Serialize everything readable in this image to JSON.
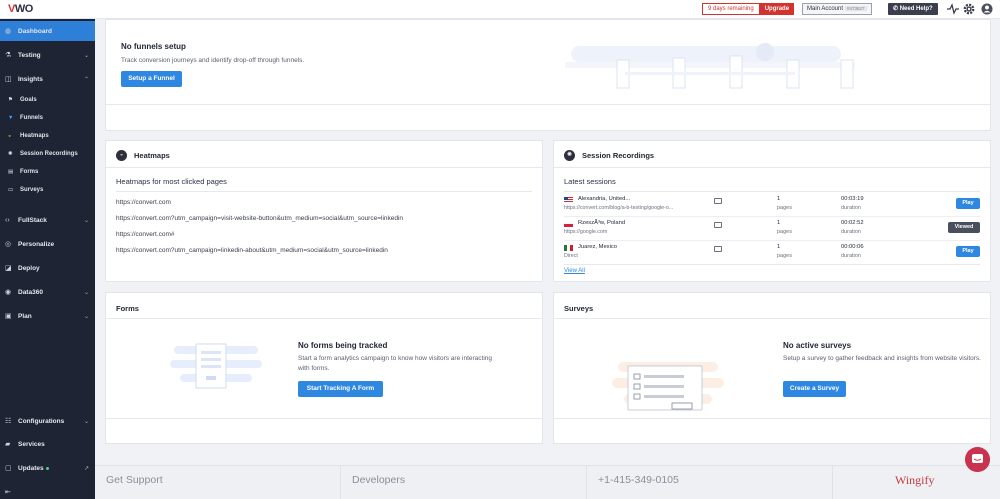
{
  "topbar": {
    "logo_prefix": "V",
    "logo_suffix": "WO",
    "trial_remaining": "9 days remaining",
    "upgrade_label": "Upgrade",
    "account_label": "Main Account",
    "account_id": "#473627",
    "help_label": "Need Help?",
    "icons": [
      "activity-icon",
      "gear-icon",
      "user-icon"
    ]
  },
  "sidebar": {
    "items": [
      {
        "label": "Dashboard",
        "icon": "dashboard-icon",
        "active": true
      },
      {
        "label": "Testing",
        "icon": "flask-icon",
        "chevron": "⌄"
      },
      {
        "label": "Insights",
        "icon": "insights-icon",
        "chevron": "⌃"
      },
      {
        "label": "FullStack",
        "icon": "code-icon",
        "chevron": "⌄"
      },
      {
        "label": "Personalize",
        "icon": "target-icon"
      },
      {
        "label": "Deploy",
        "icon": "deploy-icon"
      },
      {
        "label": "Data360",
        "icon": "database-icon",
        "chevron": "⌄"
      },
      {
        "label": "Plan",
        "icon": "plan-icon",
        "chevron": "⌄"
      },
      {
        "label": "Configurations",
        "icon": "sliders-icon",
        "chevron": "⌄"
      },
      {
        "label": "Services",
        "icon": "briefcase-icon"
      },
      {
        "label": "Updates",
        "icon": "bell-icon"
      }
    ],
    "insights_sub": [
      {
        "label": "Goals",
        "icon": "flag-icon"
      },
      {
        "label": "Funnels",
        "icon": "funnel-icon"
      },
      {
        "label": "Heatmaps",
        "icon": "heatmap-icon"
      },
      {
        "label": "Session Recordings",
        "icon": "recording-icon"
      },
      {
        "label": "Forms",
        "icon": "form-icon"
      },
      {
        "label": "Surveys",
        "icon": "survey-icon"
      }
    ],
    "collapse_icon": "collapse-icon"
  },
  "funnels": {
    "title": "No funnels setup",
    "description": "Track conversion journeys and identify drop-off through funnels.",
    "button": "Setup a Funnel"
  },
  "heatmaps": {
    "title": "Heatmaps",
    "subtitle": "Heatmaps for most clicked pages",
    "links": [
      "https://convert.com",
      "https://convert.com?utm_campaign=visit-website-button&utm_medium=social&utm_source=linkedin",
      "https://convert.com#",
      "https://convert.com?utm_campaign=linkedin-about&utm_medium=social&utm_source=linkedin"
    ]
  },
  "sessions": {
    "title": "Session Recordings",
    "subtitle": "Latest sessions",
    "rows": [
      {
        "location": "Alexandria, United...",
        "source": "https://convert.com/blog/a-b-testing/google-o...",
        "pages": "1",
        "pages_label": "pages",
        "duration": "00:03:19",
        "duration_label": "duration",
        "action": "Play",
        "flag": "us"
      },
      {
        "location": "RzeszÃ³w, Poland",
        "source": "https://google.com",
        "pages": "1",
        "pages_label": "pages",
        "duration": "00:02:52",
        "duration_label": "duration",
        "action": "Viewed",
        "flag": "pl"
      },
      {
        "location": "Juarez, Mexico",
        "source": "Direct",
        "pages": "1",
        "pages_label": "pages",
        "duration": "00:00:06",
        "duration_label": "duration",
        "action": "Play",
        "flag": "mx"
      }
    ],
    "view_all": "View All"
  },
  "forms": {
    "title": "Forms",
    "empty_title": "No forms being tracked",
    "empty_desc": "Start a form analytics campaign to know how visitors are interacting with forms.",
    "button": "Start Tracking A Form"
  },
  "surveys": {
    "title": "Surveys",
    "empty_title": "No active surveys",
    "empty_desc": "Setup a survey to gather feedback and insights from website visitors.",
    "button": "Create a Survey"
  },
  "footer": {
    "support": "Get Support",
    "developers": "Developers",
    "phone": "+1-415-349-0105",
    "brand": "Wingify"
  }
}
